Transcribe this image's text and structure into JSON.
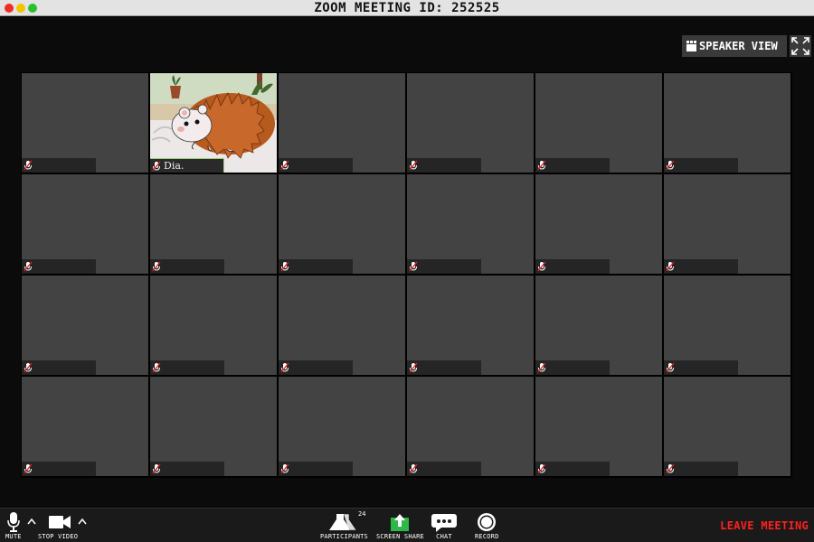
{
  "window": {
    "title": "ZOOM MEETING ID: 252525"
  },
  "view_controls": {
    "speaker_view_label": "SPEAKER VIEW"
  },
  "participants": [
    {
      "name": "",
      "video": false
    },
    {
      "name": "Dia.",
      "video": true,
      "image": "hedgehog-video"
    },
    {
      "name": "",
      "video": false
    },
    {
      "name": "",
      "video": false
    },
    {
      "name": "",
      "video": false
    },
    {
      "name": "",
      "video": false
    },
    {
      "name": "",
      "video": false
    },
    {
      "name": "",
      "video": false
    },
    {
      "name": "",
      "video": false
    },
    {
      "name": "",
      "video": false
    },
    {
      "name": "",
      "video": false
    },
    {
      "name": "",
      "video": false
    },
    {
      "name": "",
      "video": false
    },
    {
      "name": "",
      "video": false
    },
    {
      "name": "",
      "video": false
    },
    {
      "name": "",
      "video": false
    },
    {
      "name": "",
      "video": false
    },
    {
      "name": "",
      "video": false
    },
    {
      "name": "",
      "video": false
    },
    {
      "name": "",
      "video": false
    },
    {
      "name": "",
      "video": false
    },
    {
      "name": "",
      "video": false
    },
    {
      "name": "",
      "video": false
    },
    {
      "name": "",
      "video": false
    }
  ],
  "toolbar": {
    "mute_label": "MUTE",
    "stop_video_label": "STOP VIDEO",
    "participants_label": "PARTICIPANTS",
    "participants_count": "24",
    "screen_share_label": "SCREEN SHARE",
    "chat_label": "CHAT",
    "record_label": "RECORD",
    "leave_label": "LEAVE MEETING"
  },
  "colors": {
    "leave": "#ff2020",
    "screen_share": "#2fb84a",
    "active_speaker": "#9fcf7a",
    "muted_mic": "#e02020"
  }
}
